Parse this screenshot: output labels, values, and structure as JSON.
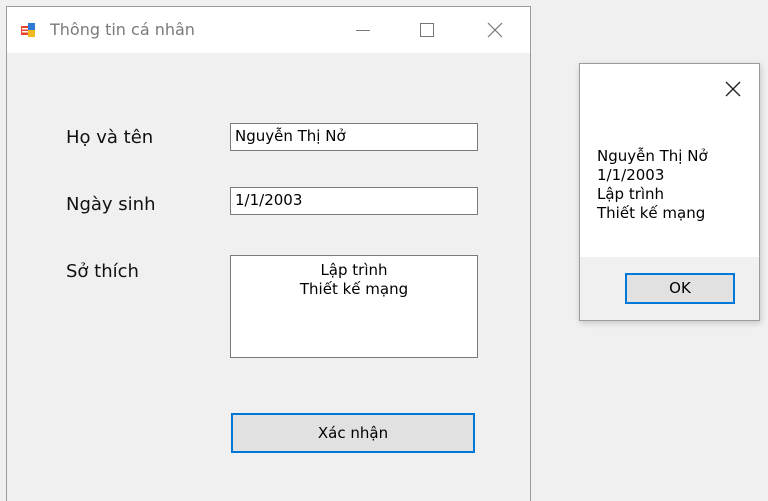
{
  "main_window": {
    "title": "Thông tin cá nhân",
    "labels": {
      "name": "Họ và tên",
      "birthdate": "Ngày sinh",
      "hobbies": "Sở thích"
    },
    "fields": {
      "name": "Nguyễn Thị Nở",
      "birthdate": "1/1/2003"
    },
    "hobbies": [
      "Lập trình",
      "Thiết kế mạng"
    ],
    "confirm_label": "Xác nhận"
  },
  "message_box": {
    "lines": [
      "Nguyễn Thị Nở",
      "1/1/2003",
      "Lập trình",
      "Thiết kế mạng"
    ],
    "ok_label": "OK"
  },
  "icons": {
    "app": "form-app-icon",
    "minimize": "minimize-icon",
    "maximize": "maximize-icon",
    "close": "close-icon"
  },
  "colors": {
    "accent": "#0078d7",
    "window_bg": "#f0f0f0",
    "titlebar_bg": "#ffffff",
    "button_bg": "#e1e1e1"
  }
}
